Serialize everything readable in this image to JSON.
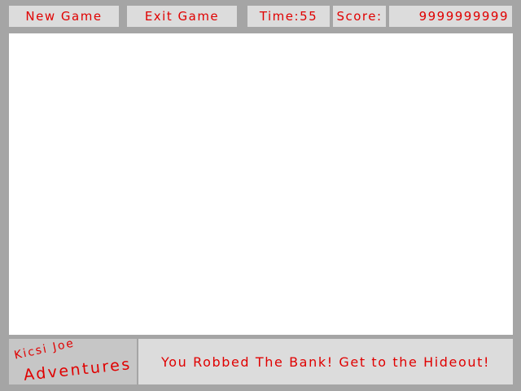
{
  "toolbar": {
    "new_game_label": "New Game",
    "exit_game_label": "Exit Game",
    "time_text": "Time:55",
    "score_label": "Score:",
    "score_value": "9999999999"
  },
  "logo": {
    "line1": "Kicsi Joe",
    "line2": "Adventures"
  },
  "status": {
    "message": "You Robbed The Bank! Get to the Hideout!"
  },
  "colors": {
    "text": "#e00000",
    "panel": "#dcdcdc",
    "background": "#a5a5a5",
    "game_area": "#ffffff"
  }
}
